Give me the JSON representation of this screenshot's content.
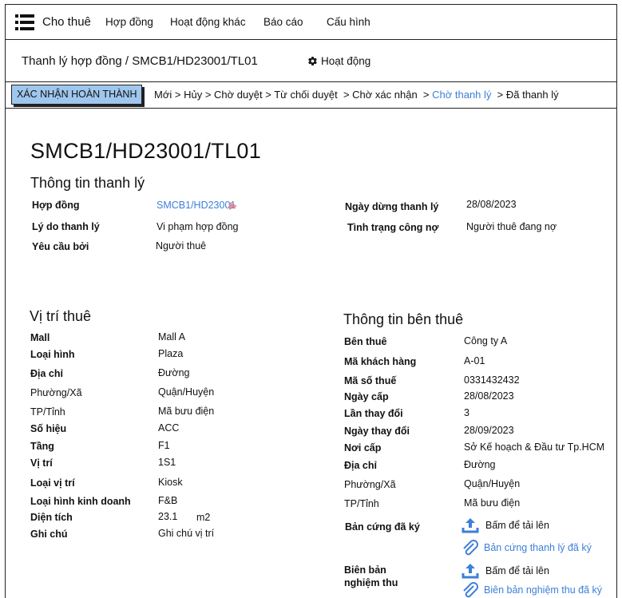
{
  "app": {
    "brand": "Cho thuê",
    "nav": [
      "Hợp đồng",
      "Hoạt động khác",
      "Báo cáo",
      "Cấu hình"
    ]
  },
  "header": {
    "path": "Thanh lý hợp đồng / SMCB1/HD23001/TL01",
    "activity": "Hoạt động"
  },
  "status": {
    "confirm_label": "XÁC NHẬN HOÀN THÀNH",
    "steps": [
      "Mới",
      "Hủy",
      "Chờ duyệt",
      "Từ chối duyệt",
      "Chờ xác nhận",
      "Chờ thanh lý",
      "Đã thanh lý"
    ],
    "active_step": "Chờ thanh lý"
  },
  "document": {
    "title": "SMCB1/HD23001/TL01"
  },
  "liquidation": {
    "section": "Thông tin thanh lý",
    "contract_label": "Hợp đồng",
    "contract_value": "SMCB1/HD23001",
    "reason_label": "Lý do thanh lý",
    "reason_value": "Vi phạm hợp đồng",
    "requested_label": "Yêu cầu bởi",
    "requested_value": "Người thuê",
    "stop_date_label": "Ngày dừng thanh lý",
    "stop_date_value": "28/08/2023",
    "debt_label": "Tình trạng công nợ",
    "debt_value": "Người thuê đang nợ"
  },
  "location": {
    "section": "Vị trí thuê",
    "rows": [
      {
        "label": "Mall",
        "value": "Mall A",
        "bold": true
      },
      {
        "label": "Loại hình",
        "value": "Plaza",
        "bold": true
      },
      {
        "label": "Địa chỉ",
        "value": "Đường",
        "bold": true
      },
      {
        "label": "Phường/Xã",
        "value": "Quận/Huyện",
        "bold": false
      },
      {
        "label": "TP/Tỉnh",
        "value": "Mã bưu điện",
        "bold": false
      },
      {
        "label": "Số hiệu",
        "value": "ACC",
        "bold": true
      },
      {
        "label": "Tầng",
        "value": "F1",
        "bold": true
      },
      {
        "label": "Vị trí",
        "value": "1S1",
        "bold": true
      },
      {
        "label": "Loại vị trí",
        "value": "Kiosk",
        "bold": true
      },
      {
        "label": "Loại hình kinh doanh",
        "value": "F&B",
        "bold": true
      },
      {
        "label": "Diện tích",
        "value": "23.1",
        "bold": true
      },
      {
        "label": "Ghi chú",
        "value": "Ghi chú vị trí",
        "bold": true
      }
    ],
    "area_unit": "m2"
  },
  "tenant": {
    "section": "Thông tin bên thuê",
    "rows": [
      {
        "label": "Bên thuê",
        "value": "Công ty A",
        "bold": true
      },
      {
        "label": "Mã khách hàng",
        "value": "A-01",
        "bold": true
      },
      {
        "label": "Mã số thuế",
        "value": "0331432432",
        "bold": true
      },
      {
        "label": "Ngày cấp",
        "value": "28/08/2023",
        "bold": true
      },
      {
        "label": "Lần thay đổi",
        "value": "3",
        "bold": true
      },
      {
        "label": "Ngày thay đổi",
        "value": "28/09/2023",
        "bold": true
      },
      {
        "label": "Nơi cấp",
        "value": "Sở Kế hoạch & Đầu tư Tp.HCM",
        "bold": true
      },
      {
        "label": "Địa chỉ",
        "value": "Đường",
        "bold": true
      },
      {
        "label": "Phường/Xã",
        "value": "Quận/Huyện",
        "bold": false
      },
      {
        "label": "TP/Tỉnh",
        "value": "Mã bưu điện",
        "bold": false
      }
    ],
    "signed_copy_label": "Bản cứng đã ký",
    "signed_copy_upload": "Bấm để tải lên",
    "signed_copy_file": "Bản cứng thanh lý đã ký",
    "acceptance_label_1": "Biên bản",
    "acceptance_label_2": "nghiệm thu",
    "acceptance_upload": "Bấm để tải lên",
    "acceptance_file": "Biên bản nghiệm thu đã ký"
  },
  "colors": {
    "accent": "#3d7fd9",
    "button_bg": "#9fc7ee",
    "border": "#222222"
  }
}
